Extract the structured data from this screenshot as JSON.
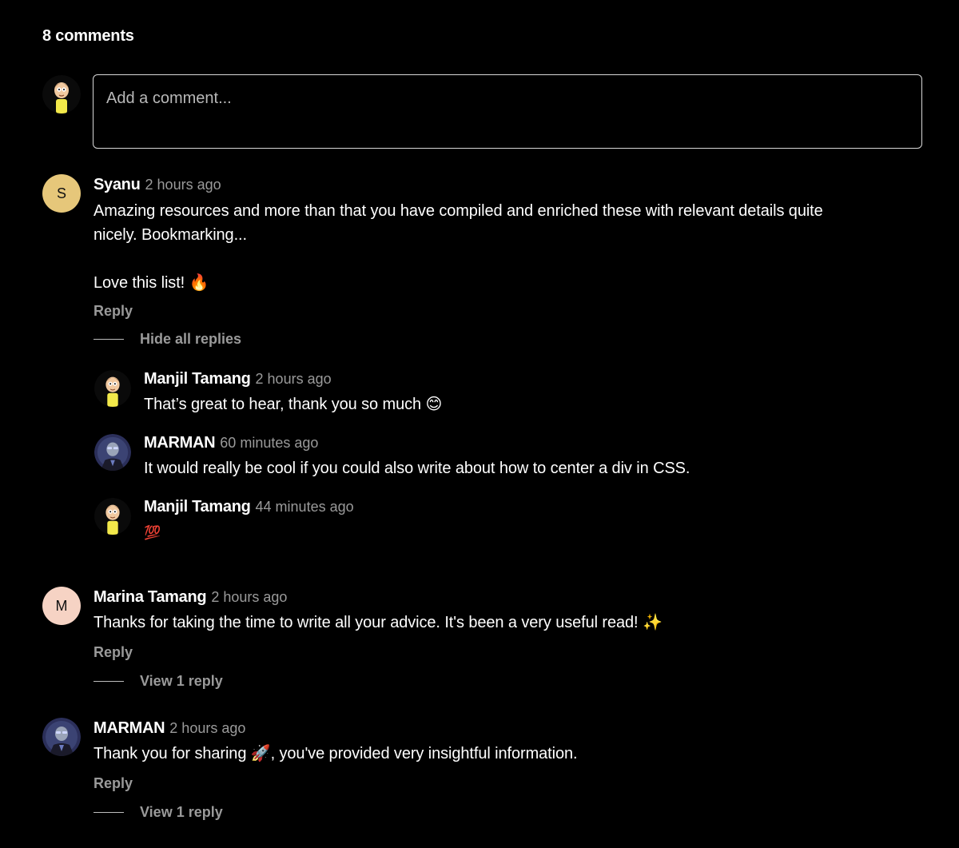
{
  "header": {
    "count_label": "8 comments"
  },
  "composer": {
    "placeholder": "Add a comment..."
  },
  "comments": [
    {
      "author": "Syanu",
      "time": "2 hours ago",
      "avatar_letter": "S",
      "avatar_color": "#e6c77a",
      "line1": "Amazing resources and more than that you have compiled and enriched these with relevant details quite",
      "line2": "nicely. Bookmarking...",
      "line3": "Love this list! 🔥",
      "reply_label": "Reply",
      "toggle_label": "Hide all replies",
      "replies": [
        {
          "author": "Manjil Tamang",
          "time": "2 hours ago",
          "text": "That’s great to hear, thank you so much 😊"
        },
        {
          "author": "MARMAN",
          "time": "60 minutes ago",
          "text": "It would really be cool if you could also write about how to center a div in CSS."
        },
        {
          "author": "Manjil Tamang",
          "time": "44 minutes ago",
          "text": "💯"
        }
      ]
    },
    {
      "author": "Marina Tamang",
      "time": "2 hours ago",
      "avatar_letter": "M",
      "avatar_color": "#f6d3c4",
      "text": "Thanks for taking the time to write all your advice. It's been a very useful read!  ✨",
      "reply_label": "Reply",
      "toggle_label": "View 1 reply"
    },
    {
      "author": "MARMAN",
      "time": "2 hours ago",
      "text": "Thank you for sharing 🚀, you've provided very insightful information.",
      "reply_label": "Reply",
      "toggle_label": "View 1 reply"
    }
  ]
}
